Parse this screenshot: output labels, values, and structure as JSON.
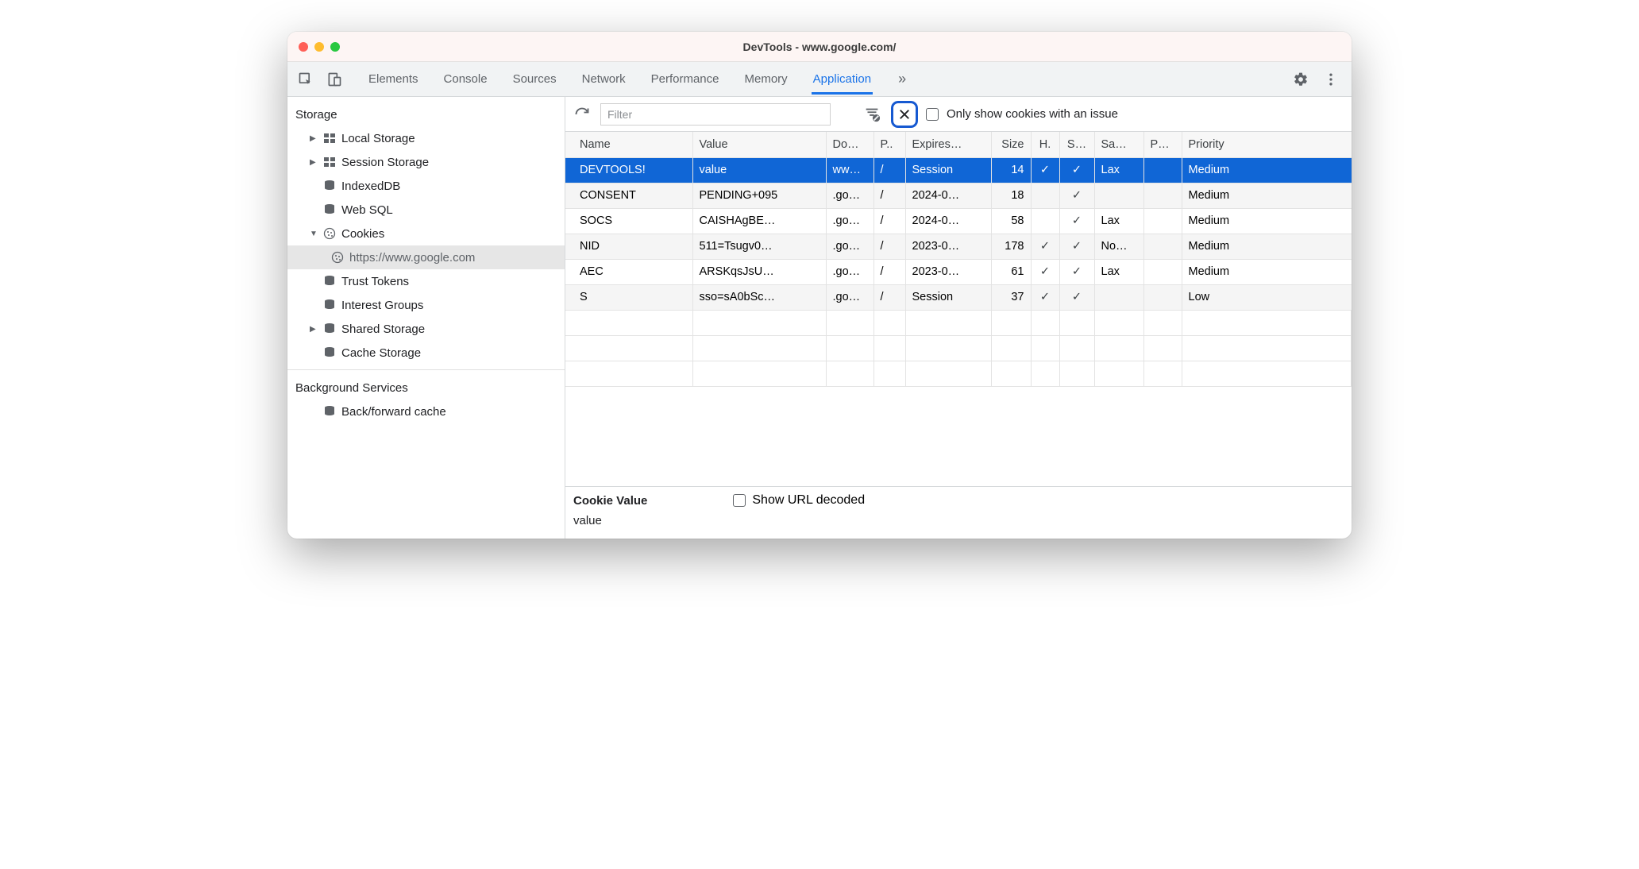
{
  "window": {
    "title": "DevTools - www.google.com/"
  },
  "tabs": [
    "Elements",
    "Console",
    "Sources",
    "Network",
    "Performance",
    "Memory",
    "Application"
  ],
  "active_tab": "Application",
  "filterbar": {
    "placeholder": "Filter",
    "issue_label": "Only show cookies with an issue"
  },
  "sidebar": {
    "storage_title": "Storage",
    "items": [
      {
        "label": "Local Storage"
      },
      {
        "label": "Session Storage"
      },
      {
        "label": "IndexedDB"
      },
      {
        "label": "Web SQL"
      },
      {
        "label": "Cookies"
      },
      {
        "label": "https://www.google.com"
      },
      {
        "label": "Trust Tokens"
      },
      {
        "label": "Interest Groups"
      },
      {
        "label": "Shared Storage"
      },
      {
        "label": "Cache Storage"
      }
    ],
    "bg_title": "Background Services",
    "bg_items": [
      {
        "label": "Back/forward cache"
      }
    ]
  },
  "columns": [
    "Name",
    "Value",
    "Do…",
    "P..",
    "Expires…",
    "Size",
    "H.",
    "S…",
    "Sa…",
    "P…",
    "Priority"
  ],
  "rows": [
    {
      "name": "DEVTOOLS!",
      "value": "value",
      "domain": "ww…",
      "path": "/",
      "expires": "Session",
      "size": "14",
      "httponly": "✓",
      "secure": "✓",
      "samesite": "Lax",
      "partition": "",
      "priority": "Medium"
    },
    {
      "name": "CONSENT",
      "value": "PENDING+095",
      "domain": ".go…",
      "path": "/",
      "expires": "2024-0…",
      "size": "18",
      "httponly": "",
      "secure": "✓",
      "samesite": "",
      "partition": "",
      "priority": "Medium"
    },
    {
      "name": "SOCS",
      "value": "CAISHAgBE…",
      "domain": ".go…",
      "path": "/",
      "expires": "2024-0…",
      "size": "58",
      "httponly": "",
      "secure": "✓",
      "samesite": "Lax",
      "partition": "",
      "priority": "Medium"
    },
    {
      "name": "NID",
      "value": "511=Tsugv0…",
      "domain": ".go…",
      "path": "/",
      "expires": "2023-0…",
      "size": "178",
      "httponly": "✓",
      "secure": "✓",
      "samesite": "No…",
      "partition": "",
      "priority": "Medium"
    },
    {
      "name": "AEC",
      "value": "ARSKqsJsU…",
      "domain": ".go…",
      "path": "/",
      "expires": "2023-0…",
      "size": "61",
      "httponly": "✓",
      "secure": "✓",
      "samesite": "Lax",
      "partition": "",
      "priority": "Medium"
    },
    {
      "name": "S",
      "value": "sso=sA0bSc…",
      "domain": ".go…",
      "path": "/",
      "expires": "Session",
      "size": "37",
      "httponly": "✓",
      "secure": "✓",
      "samesite": "",
      "partition": "",
      "priority": "Low"
    }
  ],
  "detail": {
    "label": "Cookie Value",
    "decoded_label": "Show URL decoded",
    "value": "value"
  }
}
